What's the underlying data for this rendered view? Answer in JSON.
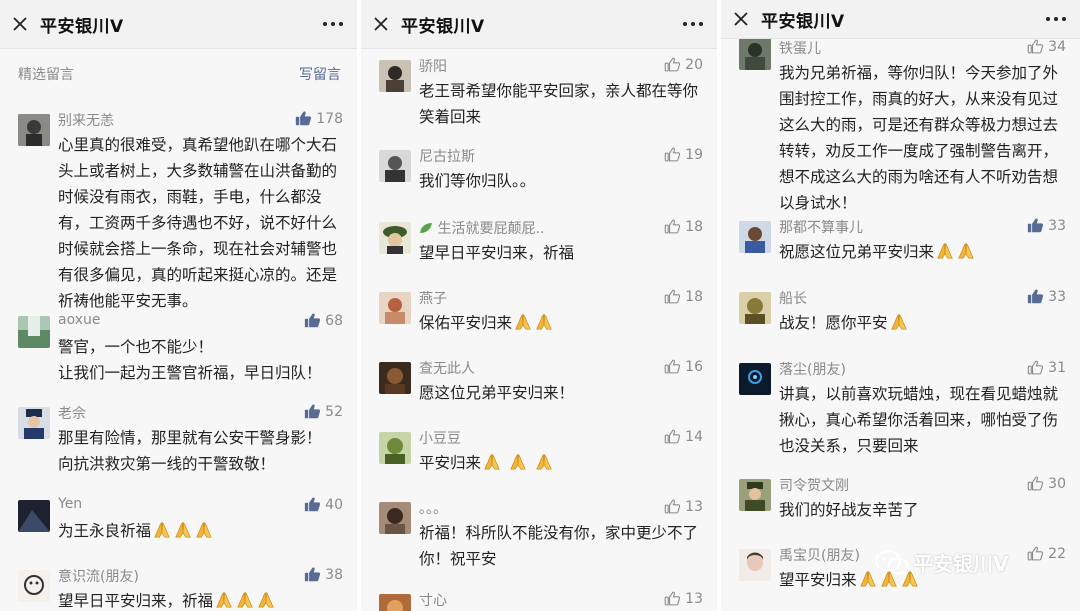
{
  "panels": [
    {
      "title": "平安银川V",
      "section_title": "精选留言",
      "write_label": "写留言",
      "comments": [
        {
          "name": "别来无恙",
          "likes": "178",
          "text": "心里真的很难受，真希望他趴在哪个大石头上或者树上，大多数辅警在山洪备勤的时候没有雨衣，雨鞋，手电，什么都没有，工资两千多待遇也不好，说不好什么时候就会搭上一条命，现在社会对辅警也有很多偏见，真的听起来挺心凉的。还是祈祷他能平安无事。"
        },
        {
          "name": "aoxue",
          "likes": "68",
          "lines": [
            "警官，一个也不能少！",
            "让我们一起为王警官祈福，早日归队！"
          ]
        },
        {
          "name": "老佘",
          "likes": "52",
          "lines": [
            "那里有险情，那里就有公安干警身影！",
            "向抗洪救灾第一线的干警致敬！"
          ]
        },
        {
          "name": "Yen",
          "likes": "40",
          "text": "为王永良祈福"
        },
        {
          "name": "意识流(朋友)",
          "likes": "38",
          "text": "望早日平安归来，祈福"
        }
      ]
    },
    {
      "title": "平安银川V",
      "comments": [
        {
          "name": "骄阳",
          "likes": "20",
          "text": "老王哥希望你能平安回家，亲人都在等你笑着回来"
        },
        {
          "name": "尼古拉斯",
          "likes": "19",
          "text": "我们等你归队。。"
        },
        {
          "name": "生活就要屁颠屁..",
          "likes": "18",
          "text": "望早日平安归来，祈福"
        },
        {
          "name": "燕子",
          "likes": "18",
          "text": "保佑平安归来"
        },
        {
          "name": "查无此人",
          "likes": "16",
          "text": "愿这位兄弟平安归来！"
        },
        {
          "name": "小豆豆",
          "likes": "14",
          "text": "平安归来"
        },
        {
          "name": "。。。",
          "likes": "13",
          "text": "祈福！科所队不能没有你，家中更少不了你！祝平安"
        },
        {
          "name": "寸心",
          "likes": "13"
        }
      ]
    },
    {
      "title": "平安银川V",
      "comments": [
        {
          "name": "铁蛋儿",
          "likes": "34",
          "text": "我为兄弟祈福，等你归队！今天参加了外围封控工作，雨真的好大，从来没有见过这么大的雨，可是还有群众等极力想过去转转，劝反工作一度成了强制警告离开，想不成这么大的雨为啥还有人不听劝告想以身试水！"
        },
        {
          "name": "那都不算事儿",
          "likes": "33",
          "text": "祝愿这位兄弟平安归来"
        },
        {
          "name": "船长",
          "likes": "33",
          "text": "战友！愿你平安"
        },
        {
          "name": "落尘(朋友)",
          "likes": "31",
          "text": "讲真，以前喜欢玩蜡烛，现在看见蜡烛就揪心，真心希望你活着回来，哪怕受了伤也没关系，只要回来"
        },
        {
          "name": "司令贺文刚",
          "likes": "30",
          "text": "我们的好战友辛苦了"
        },
        {
          "name": "禹宝贝(朋友)",
          "likes": "22",
          "text": "望平安归来"
        }
      ]
    }
  ],
  "watermark": "平安银川V",
  "colors": {
    "link": "#576b95",
    "meta": "#8a8a8a",
    "thumb_filled": "#576b95"
  }
}
